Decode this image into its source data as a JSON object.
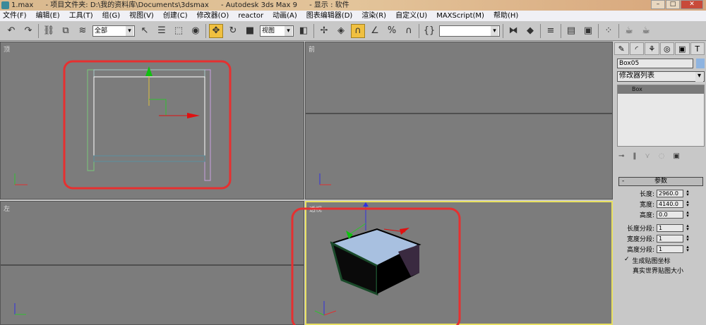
{
  "title": {
    "file": "1.max",
    "project": "- 项目文件夹: D:\\我的资料库\\Documents\\3dsmax",
    "app": "- Autodesk 3ds Max 9",
    "display": "- 显示 : 软件"
  },
  "menu": [
    "文件(F)",
    "编辑(E)",
    "工具(T)",
    "组(G)",
    "视图(V)",
    "创建(C)",
    "修改器(O)",
    "reactor",
    "动画(A)",
    "图表编辑器(D)",
    "渲染(R)",
    "自定义(U)",
    "MAXScript(M)",
    "帮助(H)"
  ],
  "toolbar": {
    "selection_filter": "全部",
    "reference_coord": "视图",
    "named_selection": ""
  },
  "viewports": {
    "top": "顶",
    "front": "前",
    "left": "左",
    "perspective": "透视"
  },
  "command_panel": {
    "object_name": "Box05",
    "object_color": "#8fb4e0",
    "modifier_list": "修改器列表",
    "stack_item": "Box",
    "rollout_title": "参数",
    "params": [
      {
        "label": "长度:",
        "value": "2960.0"
      },
      {
        "label": "宽度:",
        "value": "4140.0"
      },
      {
        "label": "高度:",
        "value": "0.0"
      },
      {
        "label": "长度分段:",
        "value": "1"
      },
      {
        "label": "宽度分段:",
        "value": "1"
      },
      {
        "label": "高度分段:",
        "value": "1"
      }
    ],
    "gen_mapping": "生成贴图坐标",
    "real_world": "真实世界贴图大小"
  },
  "colors": {
    "highlight": "#e63030",
    "active_viewport": "#e8e060"
  }
}
